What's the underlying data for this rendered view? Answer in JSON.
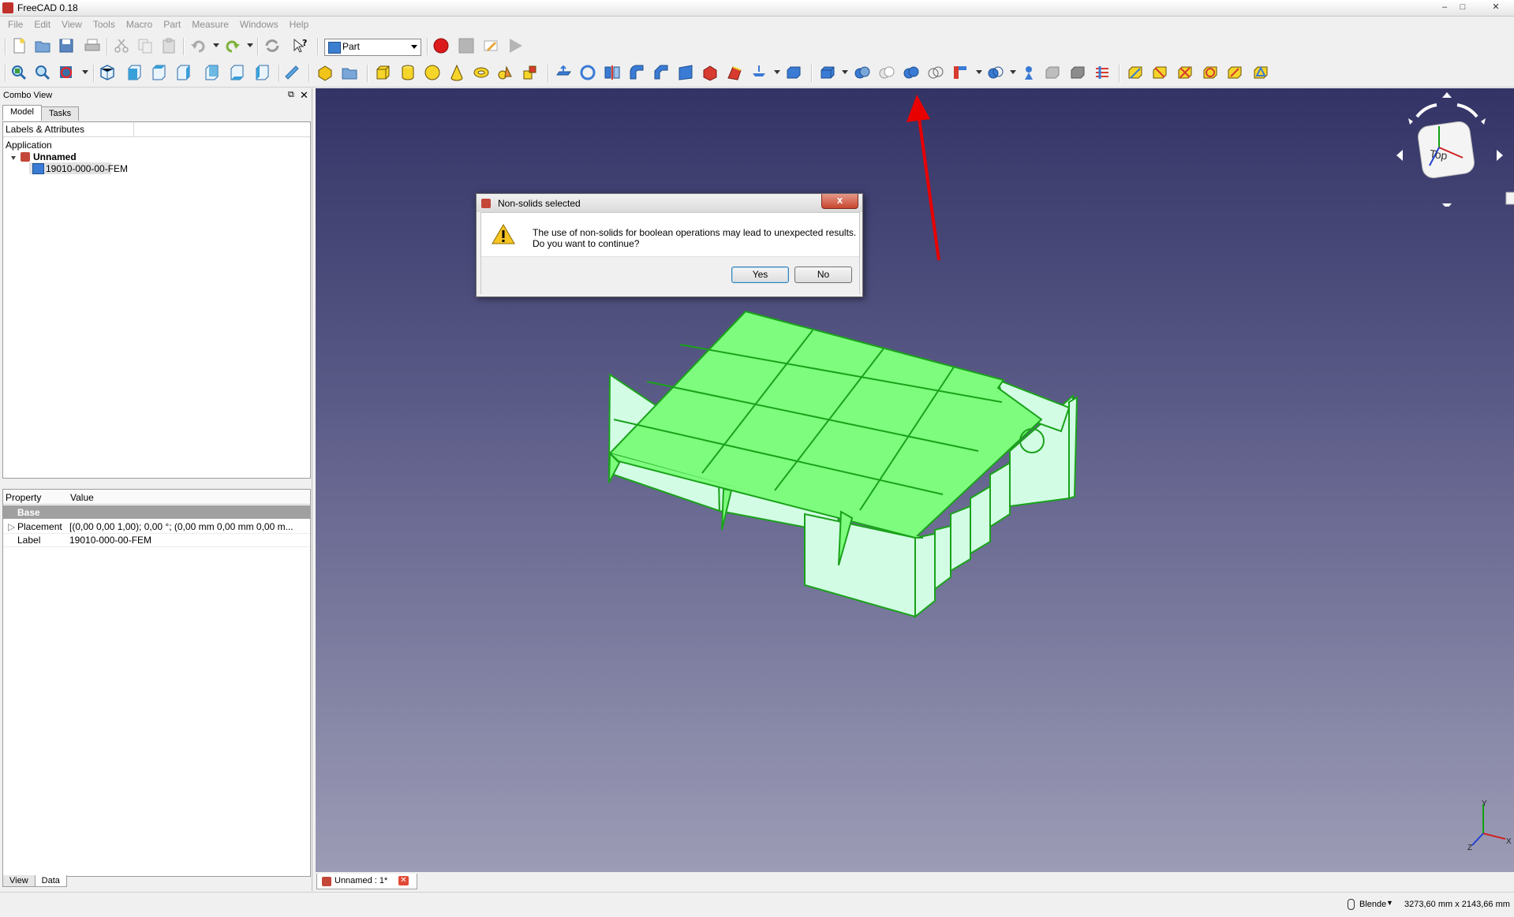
{
  "window": {
    "title": "FreeCAD 0.18",
    "controls": [
      "minimize",
      "maximize",
      "close"
    ]
  },
  "menu": [
    "File",
    "Edit",
    "View",
    "Tools",
    "Macro",
    "Part",
    "Measure",
    "Windows",
    "Help"
  ],
  "toolbar": {
    "workbench": "Part"
  },
  "combo_view": {
    "title": "Combo View",
    "tabs": [
      "Model",
      "Tasks"
    ],
    "tree_header": "Labels & Attributes",
    "tree_root": "Application",
    "document": "Unnamed",
    "object": "19010-000-00-FEM",
    "property_headers": [
      "Property",
      "Value"
    ],
    "property_group": "Base",
    "properties": [
      {
        "name": "Placement",
        "value": "[(0,00 0,00 1,00); 0,00 °; (0,00 mm  0,00 mm  0,00 m..."
      },
      {
        "name": "Label",
        "value": "19010-000-00-FEM"
      }
    ],
    "bottom_tabs": [
      "View",
      "Data"
    ]
  },
  "dialog": {
    "title": "Non-solids selected",
    "message_line1": "The use of non-solids for boolean operations may lead to unexpected results.",
    "message_line2": "Do you want to continue?",
    "yes_label": "Yes",
    "no_label": "No",
    "close_glyph": "x"
  },
  "navcube": {
    "face_label": "Top",
    "axes": [
      "X",
      "Y",
      "Z"
    ]
  },
  "document_tab": {
    "label": "Unnamed : 1*"
  },
  "status": {
    "navigation": "Blende",
    "dimensions": "3273,60 mm x 2143,66 mm"
  },
  "colors": {
    "model_top": "#7dfc7d",
    "model_side": "#d2fde4",
    "edges": "#1aa21a",
    "arrow": "#e80000"
  }
}
